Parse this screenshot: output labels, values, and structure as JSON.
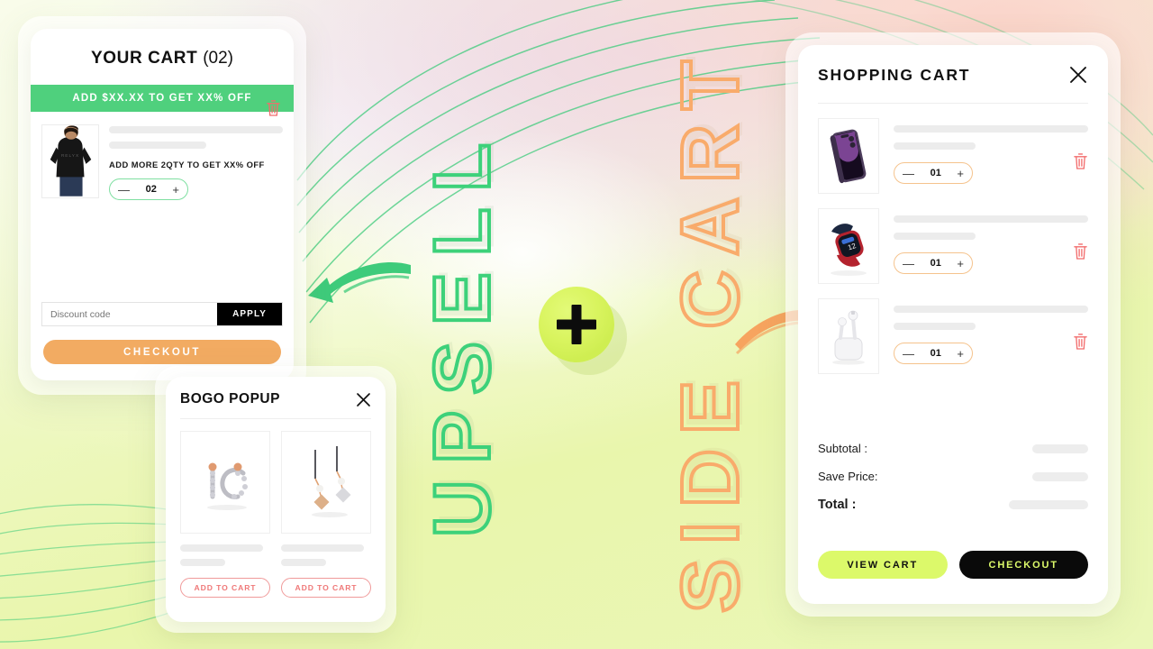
{
  "theme": {
    "bg_lime": "#eaf7b8",
    "bg_pink": "#facdc1",
    "bg_lavender": "#e2cef0",
    "green_accent": "#3dd17a",
    "green_banner": "#4fd07d",
    "orange_accent": "#f9ab6b",
    "orange_button": "#f2ab62",
    "lime_button": "#dcf96a",
    "red_accent": "#ef7878",
    "black": "#0a0a0a"
  },
  "headline_words": {
    "upsell": "UPSELL",
    "side_cart": "SIDE CART"
  },
  "plus_badge": {
    "icon": "plus-icon"
  },
  "your_cart": {
    "title": "YOUR CART",
    "count": "(02)",
    "promo_banner": "ADD $XX.XX TO GET XX% OFF",
    "item": {
      "image_alt": "black t-shirt model",
      "promo_text": "ADD MORE 2QTY TO GET XX% OFF",
      "qty": "02",
      "minus": "—",
      "plus": "+",
      "remove_icon": "trash-icon"
    },
    "discount": {
      "placeholder": "Discount code",
      "value": "",
      "apply_label": "APPLY"
    },
    "checkout_label": "CHECKOUT"
  },
  "bogo_popup": {
    "title": "BOGO POPUP",
    "close_icon": "close-icon",
    "products": [
      {
        "image_alt": "diamond hoop earrings",
        "add_to_cart_label": "ADD TO CART"
      },
      {
        "image_alt": "dangling pearl drop earrings",
        "add_to_cart_label": "ADD TO CART"
      }
    ]
  },
  "shopping_cart": {
    "title": "SHOPPING CART",
    "close_icon": "close-icon",
    "items": [
      {
        "image_alt": "purple iPhone 14 Pro",
        "qty": "01",
        "minus": "—",
        "plus": "+",
        "remove_icon": "trash-icon"
      },
      {
        "image_alt": "red and black smart watch",
        "qty": "01",
        "minus": "—",
        "plus": "+",
        "remove_icon": "trash-icon"
      },
      {
        "image_alt": "white wireless earbuds in case",
        "qty": "01",
        "minus": "—",
        "plus": "+",
        "remove_icon": "trash-icon"
      }
    ],
    "totals": [
      {
        "label": "Subtotal :",
        "value": ""
      },
      {
        "label": "Save Price:",
        "value": ""
      },
      {
        "label": "Total :",
        "value": ""
      }
    ],
    "view_cart_label": "VIEW CART",
    "checkout_label": "CHECKOUT"
  }
}
